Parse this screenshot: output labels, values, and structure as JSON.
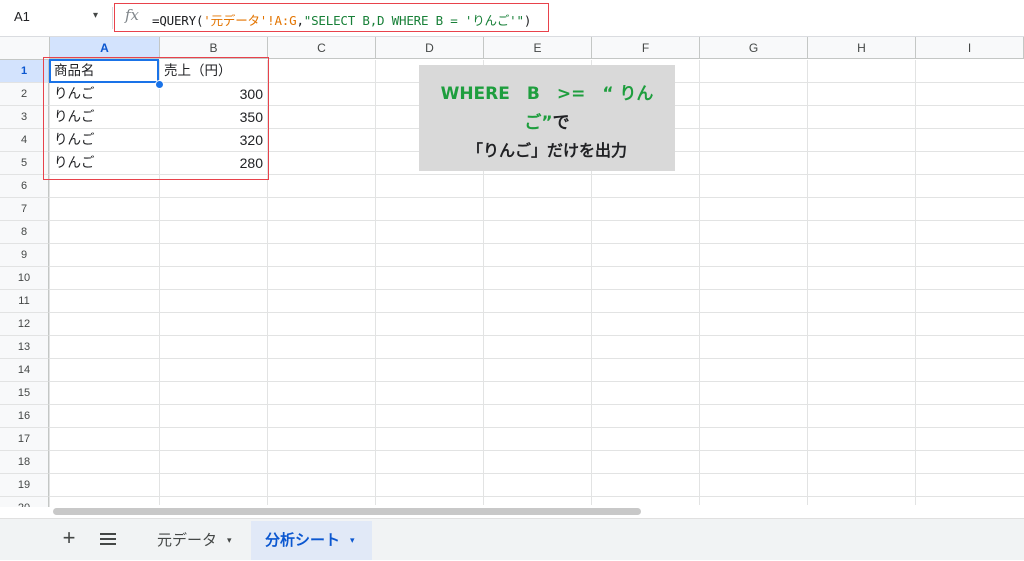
{
  "formula_bar": {
    "name_box": "A1",
    "name_box_caret": "▾",
    "fx_icon": "fx",
    "formula_prefix": "=QUERY(",
    "formula_range": "'元データ'!A:G",
    "formula_comma": ",",
    "formula_query": "\"SELECT B,D WHERE B = 'りんご'\"",
    "formula_suffix": ")"
  },
  "grid": {
    "columns": [
      "A",
      "B",
      "C",
      "D",
      "E",
      "F",
      "G",
      "H",
      "I"
    ],
    "rows": [
      "1",
      "2",
      "3",
      "4",
      "5",
      "6",
      "7",
      "8",
      "9",
      "10",
      "11",
      "12",
      "13",
      "14",
      "15",
      "16",
      "17",
      "18",
      "19",
      "20"
    ],
    "cells": {
      "A1": "商品名",
      "B1": "売上（円）",
      "A2": "りんご",
      "B2": "300",
      "A3": "りんご",
      "B3": "350",
      "A4": "りんご",
      "B4": "320",
      "A5": "りんご",
      "B5": "280"
    }
  },
  "callout": {
    "line1": "WHERE　B　>=　“ りん",
    "line2_green": "ご”",
    "line2_suffix": "で",
    "line3": "「りんご」だけを出力"
  },
  "tabs": {
    "add_icon": "+",
    "items": [
      {
        "label": "元データ",
        "caret": "▾"
      },
      {
        "label": "分析シート",
        "caret": "▾"
      }
    ]
  },
  "colors": {
    "accent_blue": "#1a73e8",
    "highlight_red": "#e8424b",
    "range_orange": "#e37400",
    "string_green": "#188038",
    "callout_green": "#1e9e3e"
  }
}
